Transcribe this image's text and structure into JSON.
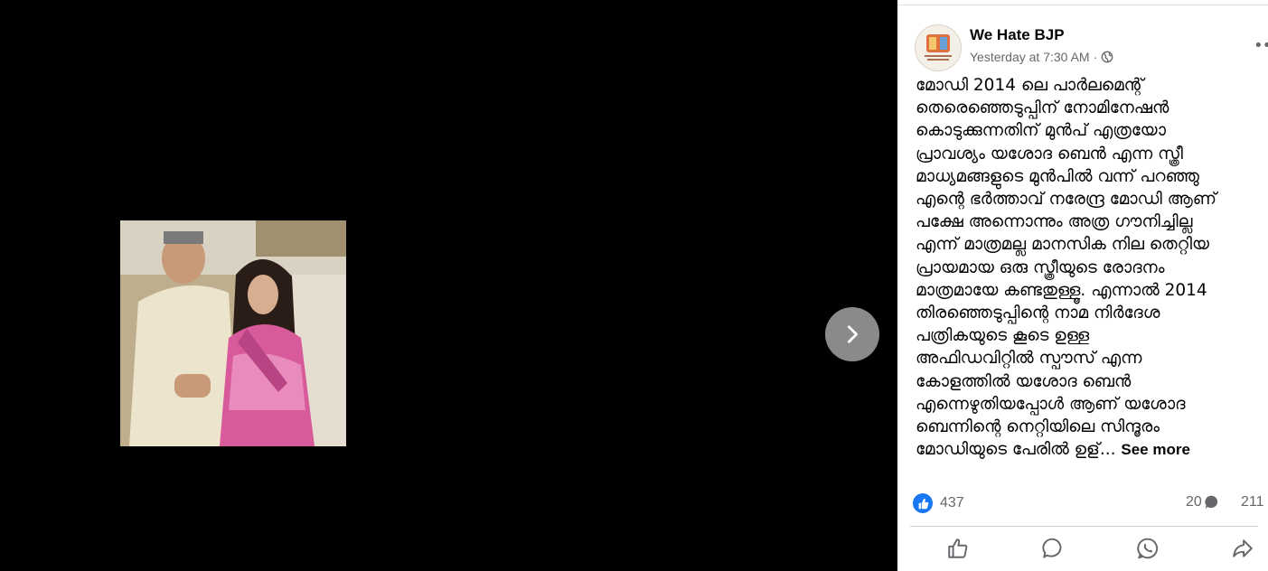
{
  "viewer": {
    "next_icon": "chevron-right-icon"
  },
  "post": {
    "page_name": "We Hate BJP",
    "timestamp": "Yesterday at 7:30 AM",
    "separator": "·",
    "audience_icon": "globe-icon",
    "more_icon": "more-dots-icon",
    "lines": [
      "മോഡി 2014 ലെ പാർലമെന്റ്",
      "തെരെഞ്ഞെടുപ്പിന് നോമിനേഷൻ",
      "കൊടുക്കുന്നതിന് മുൻപ് എത്രയോ",
      "പ്രാവശ്യം യശോദ ബെൻ എന്ന സ്ത്രീ",
      "മാധ്യമങ്ങളുടെ മുൻപിൽ വന്ന് പറഞ്ഞു",
      "എന്റെ ഭർത്താവ് നരേന്ദ്ര മോഡി ആണ്",
      "പക്ഷേ അന്നൊന്നും അത്ര ഗൗനിച്ചില്ല",
      "എന്ന് മാത്രമല്ല മാനസിക നില തെറ്റിയ",
      "പ്രായമായ ഒരു സ്ത്രീയുടെ രോദനം",
      "മാത്രമായേ കണ്ടതുള്ളൂ. എന്നാൽ 2014",
      "തിരഞ്ഞെടുപ്പിന്റെ നാമ നിർദേശ",
      "പത്രികയുടെ കൂടെ ഉള്ള",
      "അഫിഡവിറ്റിൽ സ്പൗസ് എന്ന",
      "കോളത്തിൽ യശോദ ബെൻ",
      "എന്നെഴുതിയപ്പോൾ ആണ് യശോദ",
      "ബെന്നിന്റെ നെറ്റിയിലെ സിന്ദൂരം",
      "മോഡിയുടെ പേരിൽ ഉള്..."
    ],
    "see_more": "See more",
    "reactions_count": "437",
    "comments_count": "20",
    "shares_count": "211",
    "colors": {
      "like_blue": "#1877f2",
      "secondary_text": "#65676b"
    }
  },
  "actions": {
    "like_icon": "thumbs-up-icon",
    "comment_icon": "comment-bubble-icon",
    "whatsapp_icon": "whatsapp-icon",
    "share_icon": "share-arrow-icon"
  }
}
